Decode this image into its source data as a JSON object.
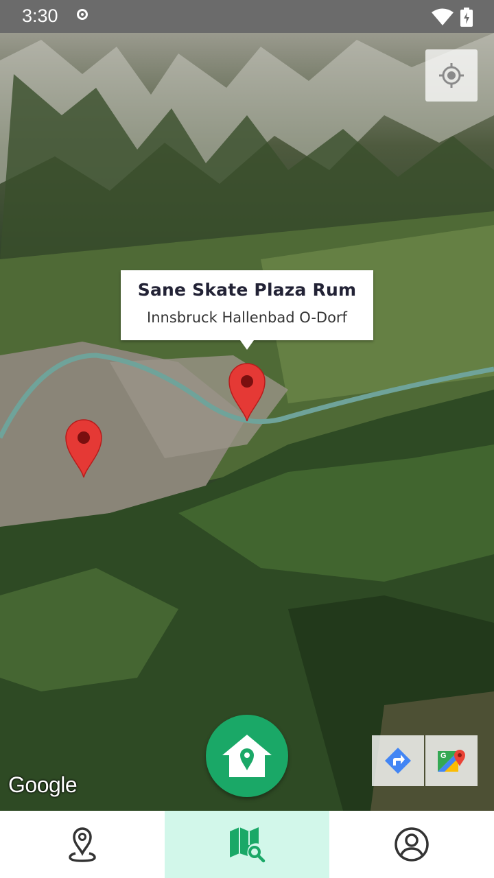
{
  "status_bar": {
    "time": "3:30"
  },
  "map": {
    "info_window": {
      "title": "Sane Skate Plaza Rum",
      "snippet": "Innsbruck Hallenbad O-Dorf"
    },
    "attribution": "Google",
    "map_type": "satellite"
  },
  "colors": {
    "accent": "#1aa867",
    "nav_active_bg": "#d2f7ea",
    "marker": "#e53935",
    "status_bar": "#6b6b6b"
  },
  "bottom_nav": {
    "items": [
      {
        "icon": "location-pin-icon",
        "active": false
      },
      {
        "icon": "map-search-icon",
        "active": true
      },
      {
        "icon": "account-icon",
        "active": false
      }
    ]
  }
}
